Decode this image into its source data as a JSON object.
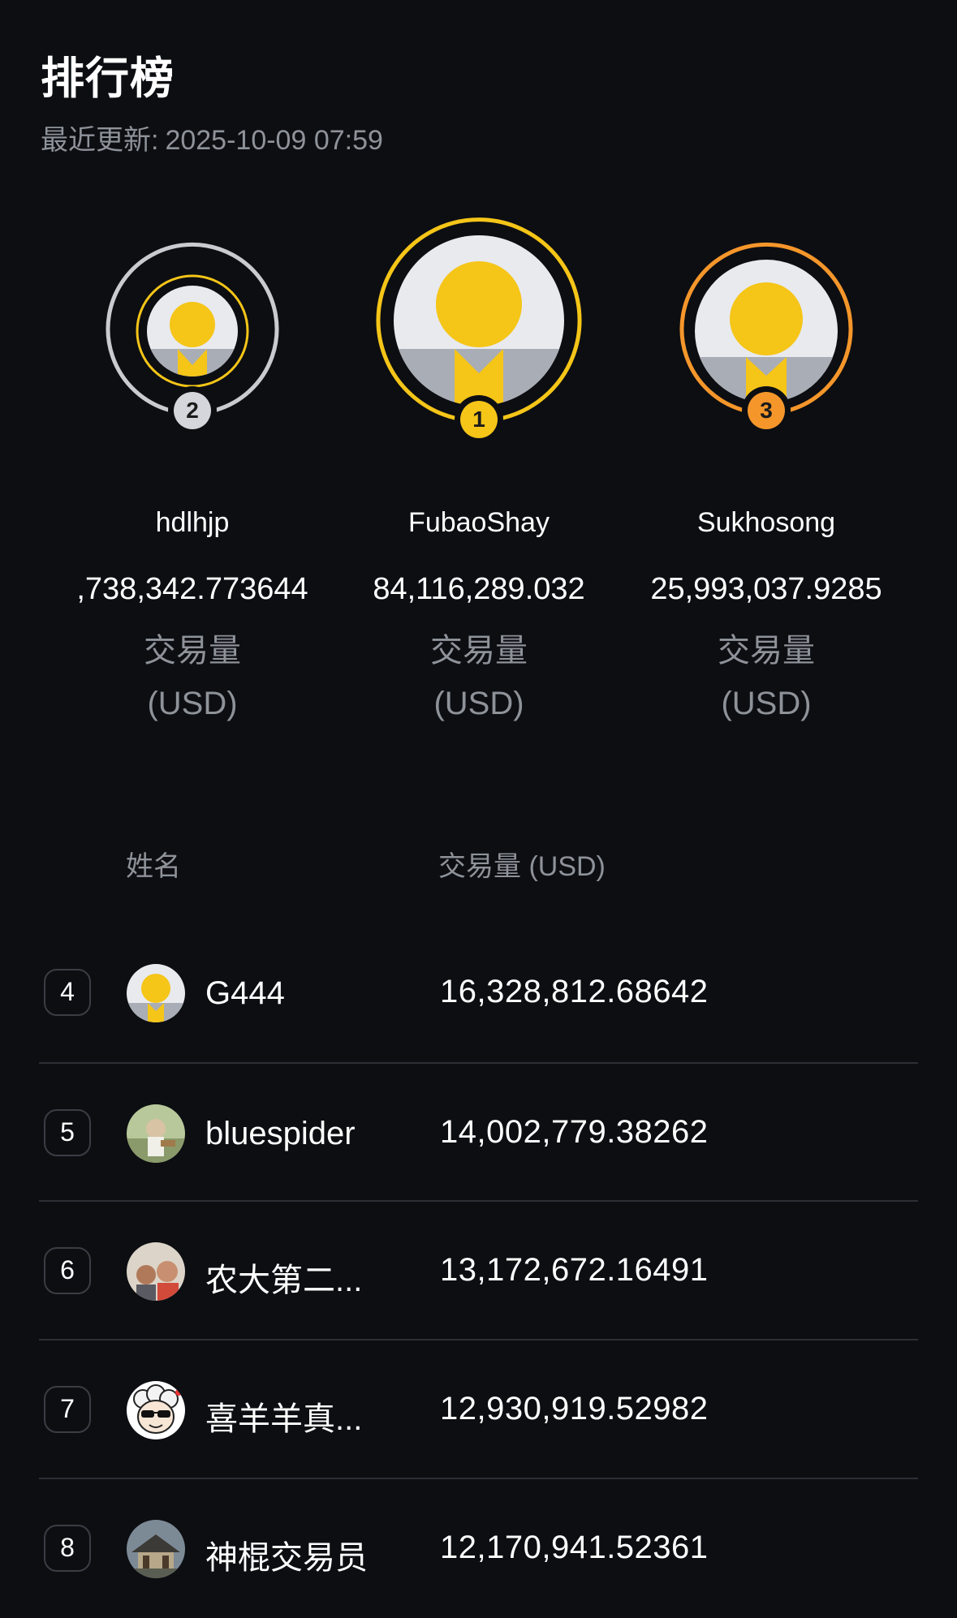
{
  "header": {
    "title": "排行榜",
    "updated_label": "最近更新:",
    "updated_time": "2025-10-09 07:59"
  },
  "podium": [
    {
      "rank": "2",
      "name": "hdlhjp",
      "volume": ",738,342.773644",
      "label_line1": "交易量",
      "label_line2": "(USD)",
      "ring_color": "#c9cbd0",
      "badge_color": "#d4d6db"
    },
    {
      "rank": "1",
      "name": "FubaoShay",
      "volume": "84,116,289.032",
      "label_line1": "交易量",
      "label_line2": "(USD)",
      "ring_color": "#f5c518",
      "badge_color": "#f5c518"
    },
    {
      "rank": "3",
      "name": "Sukhosong",
      "volume": "25,993,037.9285",
      "label_line1": "交易量",
      "label_line2": "(USD)",
      "ring_color": "#f5962b",
      "badge_color": "#f5962b"
    }
  ],
  "table": {
    "col_name": "姓名",
    "col_volume": "交易量 (USD)",
    "rows": [
      {
        "rank": "4",
        "name": "G444",
        "volume": "16,328,812.68642",
        "avatar": "default-avatar"
      },
      {
        "rank": "5",
        "name": "bluespider",
        "volume": "14,002,779.38262",
        "avatar": "photo-avatar"
      },
      {
        "rank": "6",
        "name": "农大第二...",
        "volume": "13,172,672.16491",
        "avatar": "photo-avatar"
      },
      {
        "rank": "7",
        "name": "喜羊羊真...",
        "volume": "12,930,919.52982",
        "avatar": "cartoon-sheep-avatar"
      },
      {
        "rank": "8",
        "name": "神棍交易员",
        "volume": "12,170,941.52361",
        "avatar": "photo-avatar"
      }
    ]
  }
}
